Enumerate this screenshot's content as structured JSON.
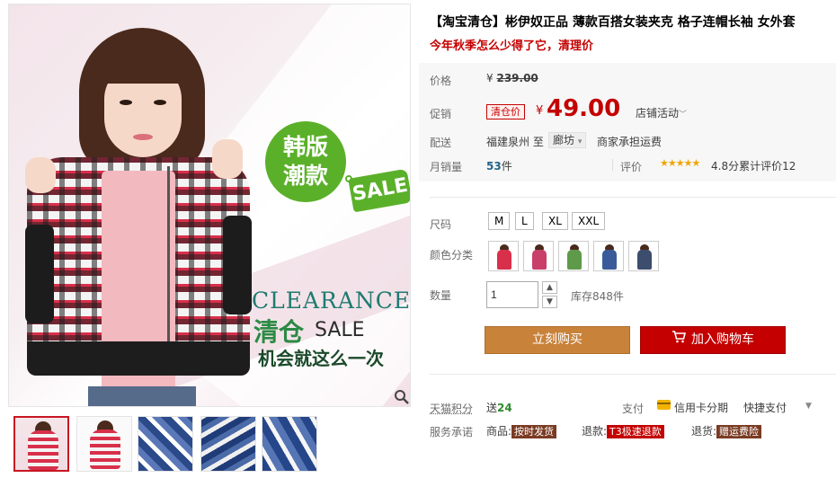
{
  "main_image": {
    "badge_line1": "韩版",
    "badge_line2": "潮款",
    "sale_tag": "SALE",
    "clearance": "CLEARANCE",
    "clear_cn": "清仓",
    "clear_sale": "SALE",
    "chance": "机会就这么一次",
    "zoom_icon": "magnifier-icon"
  },
  "thumbnails": [
    {
      "name": "thumb-1",
      "active": true
    },
    {
      "name": "thumb-2",
      "active": false
    },
    {
      "name": "thumb-3",
      "active": false
    },
    {
      "name": "thumb-4",
      "active": false
    },
    {
      "name": "thumb-5",
      "active": false
    }
  ],
  "product": {
    "title": "【淘宝清仓】彬伊奴正品 薄款百搭女装夹克 格子连帽长袖 女外套",
    "subtitle": "今年秋季怎么少得了它，清理价"
  },
  "pricing": {
    "price_label": "价格",
    "orig_currency": "¥",
    "orig_price": "239.00",
    "promo_label": "促销",
    "promo_tag": "清仓价",
    "currency": "¥",
    "promo_price": "49.00",
    "store_promo": "店铺活动",
    "ship_label": "配送",
    "ship_from": "福建泉州",
    "ship_to_word": "至",
    "ship_dest": "廊坊",
    "ship_fee": "商家承担运费",
    "sales_label": "月销量",
    "sales_count": "53",
    "sales_unit": "件",
    "rating_label": "评价",
    "stars": "★★★★★",
    "score": "4.8分",
    "reviews": "累计评价12"
  },
  "options": {
    "size_label": "尺码",
    "sizes": [
      "M",
      "L",
      "XL",
      "XXL"
    ],
    "color_label": "颜色分类",
    "swatch_colors": [
      "#d8304a",
      "#c8406a",
      "#5f9a4a",
      "#3a5a9a",
      "#3d4d6d"
    ],
    "qty_label": "数量",
    "qty_value": "1",
    "stock": "库存848件"
  },
  "actions": {
    "buy_now": "立刻购买",
    "add_cart": "加入购物车"
  },
  "extras": {
    "points_label": "天猫积分",
    "points_prefix": "送",
    "points_value": "24",
    "pay_label": "支付",
    "pay_card": "信用卡分期",
    "pay_quick": "快捷支付",
    "service_label": "服务承诺",
    "goods_prefix": "商品:",
    "goods_tag": "按时发货",
    "refund_prefix": "退款:",
    "refund_tag": "T3极速退款",
    "return_prefix": "退货:",
    "return_tag": "赠运费险"
  },
  "colors": {
    "accent_red": "#c40000",
    "buy_orange": "#c8823a",
    "badge_green": "#5bb02a"
  }
}
